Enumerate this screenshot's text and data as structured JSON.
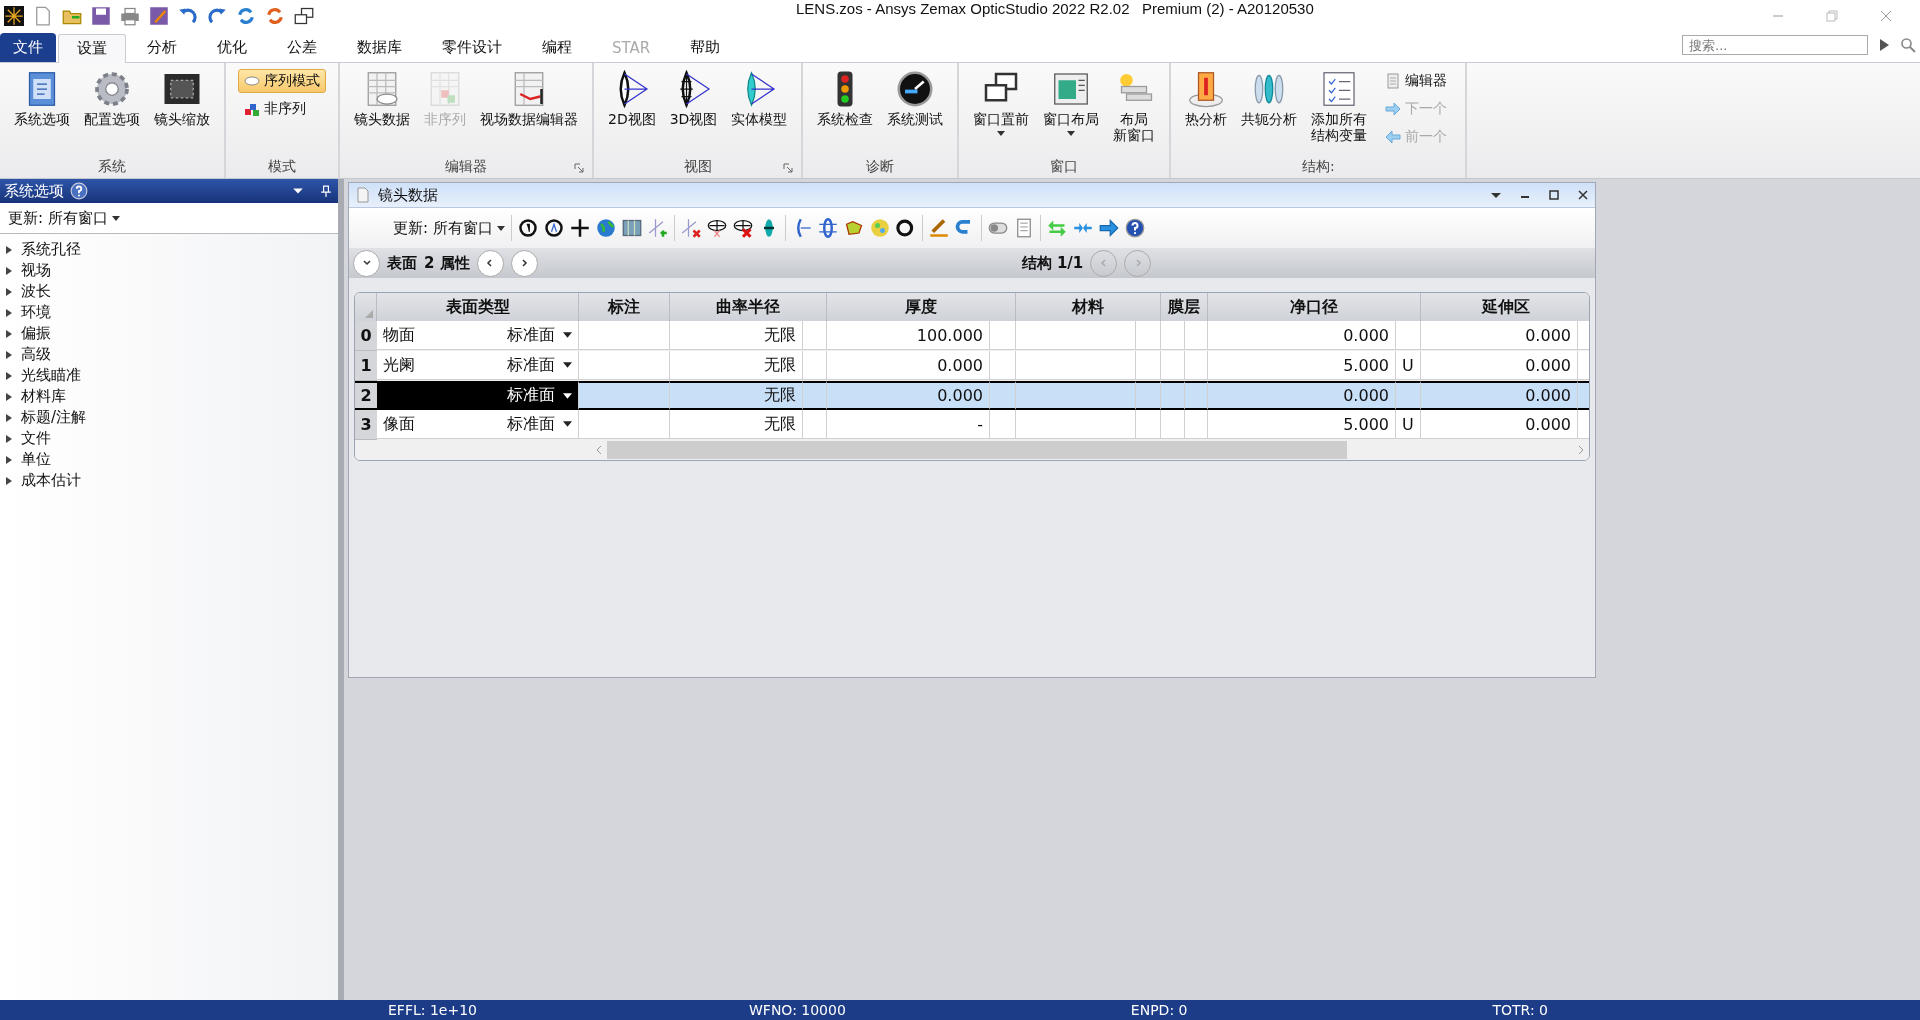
{
  "title_bar": {
    "title": "LENS.zos - Ansys Zemax OpticStudio 2022 R2.02   Premium (2) - A20120530"
  },
  "menu_tabs": [
    {
      "label": "文件",
      "kind": "file",
      "selected": false,
      "disabled": false
    },
    {
      "label": "设置",
      "kind": "tab",
      "selected": true,
      "disabled": false
    },
    {
      "label": "分析",
      "kind": "tab",
      "selected": false,
      "disabled": false
    },
    {
      "label": "优化",
      "kind": "tab",
      "selected": false,
      "disabled": false
    },
    {
      "label": "公差",
      "kind": "tab",
      "selected": false,
      "disabled": false
    },
    {
      "label": "数据库",
      "kind": "tab",
      "selected": false,
      "disabled": false
    },
    {
      "label": "零件设计",
      "kind": "tab",
      "selected": false,
      "disabled": false
    },
    {
      "label": "编程",
      "kind": "tab",
      "selected": false,
      "disabled": false
    },
    {
      "label": "STAR",
      "kind": "tab",
      "selected": false,
      "disabled": true
    },
    {
      "label": "帮助",
      "kind": "tab",
      "selected": false,
      "disabled": false
    }
  ],
  "search": {
    "placeholder": "搜索..."
  },
  "ribbon_groups": [
    {
      "label": "系统",
      "buttons": [
        {
          "lines": [
            "系统选项"
          ],
          "kind": "large",
          "disabled": false,
          "dropdown": false
        },
        {
          "lines": [
            "配置选项"
          ],
          "kind": "large",
          "disabled": false,
          "dropdown": false
        },
        {
          "lines": [
            "镜头缩放"
          ],
          "kind": "large",
          "disabled": false,
          "dropdown": false
        }
      ]
    },
    {
      "label": "模式",
      "buttons": [
        {
          "lines": [
            "序列模式"
          ],
          "kind": "small",
          "disabled": false,
          "selected": true
        },
        {
          "lines": [
            "非序列"
          ],
          "kind": "small",
          "disabled": false,
          "selected": false
        }
      ]
    },
    {
      "label": "编辑器",
      "launcher": true,
      "buttons": [
        {
          "lines": [
            "镜头数据"
          ],
          "kind": "large",
          "disabled": false,
          "dropdown": false
        },
        {
          "lines": [
            "非序列"
          ],
          "kind": "large",
          "disabled": true,
          "dropdown": false
        },
        {
          "lines": [
            "视场数据编辑器"
          ],
          "kind": "large",
          "disabled": false,
          "dropdown": false
        }
      ]
    },
    {
      "label": "视图",
      "launcher": true,
      "buttons": [
        {
          "lines": [
            "2D视图"
          ],
          "kind": "large",
          "disabled": false,
          "dropdown": false
        },
        {
          "lines": [
            "3D视图"
          ],
          "kind": "large",
          "disabled": false,
          "dropdown": false
        },
        {
          "lines": [
            "实体模型"
          ],
          "kind": "large",
          "disabled": false,
          "dropdown": false
        }
      ]
    },
    {
      "label": "诊断",
      "buttons": [
        {
          "lines": [
            "系统检查"
          ],
          "kind": "large",
          "disabled": false,
          "dropdown": false
        },
        {
          "lines": [
            "系统测试"
          ],
          "kind": "large",
          "disabled": false,
          "dropdown": false
        }
      ]
    },
    {
      "label": "窗口",
      "buttons": [
        {
          "lines": [
            "窗口置前"
          ],
          "kind": "large",
          "disabled": false,
          "dropdown": true
        },
        {
          "lines": [
            "窗口布局"
          ],
          "kind": "large",
          "disabled": false,
          "dropdown": true
        },
        {
          "lines": [
            "布局",
            "新窗口"
          ],
          "kind": "large",
          "disabled": false,
          "dropdown": false
        }
      ]
    },
    {
      "label": "结构:",
      "buttons": [
        {
          "lines": [
            "热分析"
          ],
          "kind": "large",
          "disabled": false,
          "dropdown": false
        },
        {
          "lines": [
            "共轭分析"
          ],
          "kind": "large",
          "disabled": false,
          "dropdown": false
        },
        {
          "lines": [
            "添加所有",
            "结构变量"
          ],
          "kind": "large",
          "disabled": false,
          "dropdown": false
        },
        {
          "lines": [
            "编辑器"
          ],
          "kind": "small",
          "disabled": false,
          "selected": false
        },
        {
          "lines": [
            "下一个"
          ],
          "kind": "small",
          "disabled": true,
          "selected": false
        },
        {
          "lines": [
            "前一个"
          ],
          "kind": "small",
          "disabled": true,
          "selected": false
        }
      ]
    }
  ],
  "sidebar": {
    "title": "系统选项",
    "update": "更新: 所有窗口",
    "items": [
      {
        "label": "系统孔径",
        "expanded": false
      },
      {
        "label": "视场",
        "expanded": false
      },
      {
        "label": "波长",
        "expanded": false
      },
      {
        "label": "环境",
        "expanded": false
      },
      {
        "label": "偏振",
        "expanded": false
      },
      {
        "label": "高级",
        "expanded": false
      },
      {
        "label": "光线瞄准",
        "expanded": false
      },
      {
        "label": "材料库",
        "expanded": false
      },
      {
        "label": "标题/注解",
        "expanded": false
      },
      {
        "label": "文件",
        "expanded": false
      },
      {
        "label": "单位",
        "expanded": false
      },
      {
        "label": "成本估计",
        "expanded": false
      }
    ]
  },
  "lens_data": {
    "title": "镜头数据",
    "update": "更新: 所有窗口",
    "surface_label": "表面",
    "surface_props": "2 属性",
    "config": "结构 1/1",
    "columns": [
      "表面类型",
      "标注",
      "曲率半径",
      "厚度",
      "材料",
      "膜层",
      "净口径",
      "延伸区"
    ],
    "rows": [
      {
        "index": "0",
        "name": "物面",
        "type": "标准面",
        "radius": "无限",
        "thickness": "100.000",
        "semi_diameter": "0.000",
        "extension": "0.000",
        "selected": false
      },
      {
        "index": "1",
        "name": "光阑",
        "type": "标准面",
        "radius": "无限",
        "thickness": "0.000",
        "semi_diameter": "5.000",
        "semi_flag": "U",
        "extension": "0.000",
        "selected": false
      },
      {
        "index": "2",
        "type": "标准面",
        "radius": "无限",
        "thickness": "0.000",
        "semi_diameter": "0.000",
        "extension": "0.000",
        "selected": true
      },
      {
        "index": "3",
        "name": "像面",
        "type": "标准面",
        "radius": "无限",
        "thickness": "-",
        "semi_diameter": "5.000",
        "semi_flag": "U",
        "extension": "0.000",
        "selected": false
      }
    ]
  },
  "status_bar": [
    "EFFL: 1e+10",
    "WFNO: 10000",
    "ENPD: 0",
    "TOTR: 0"
  ]
}
